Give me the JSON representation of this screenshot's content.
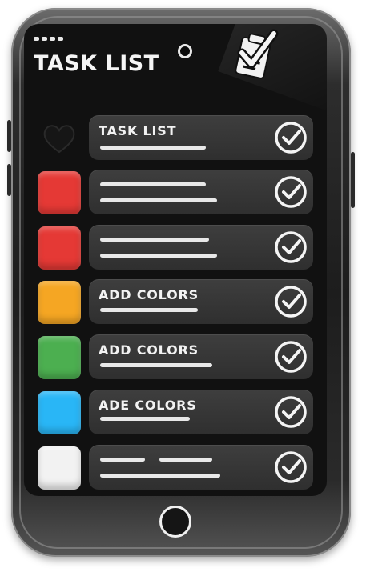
{
  "app": {
    "title": "TASK LIST"
  },
  "icons": {
    "header": "clipboard-check-icon",
    "row_action": "check-circle-icon",
    "home": "home-button-icon"
  },
  "rows": [
    {
      "swatch_color": "",
      "label": "TASK LIST",
      "checked": true
    },
    {
      "swatch_color": "#e53935",
      "label": "",
      "checked": true
    },
    {
      "swatch_color": "#e53935",
      "label": "",
      "checked": true
    },
    {
      "swatch_color": "#f5a623",
      "label": "ADD COLORS",
      "checked": true
    },
    {
      "swatch_color": "#4caf50",
      "label": "ADD COLORS",
      "checked": true
    },
    {
      "swatch_color": "#29b6f6",
      "label": "ADE COLORS",
      "checked": true
    },
    {
      "swatch_color": "#f2f2f2",
      "label": "",
      "checked": true
    }
  ]
}
